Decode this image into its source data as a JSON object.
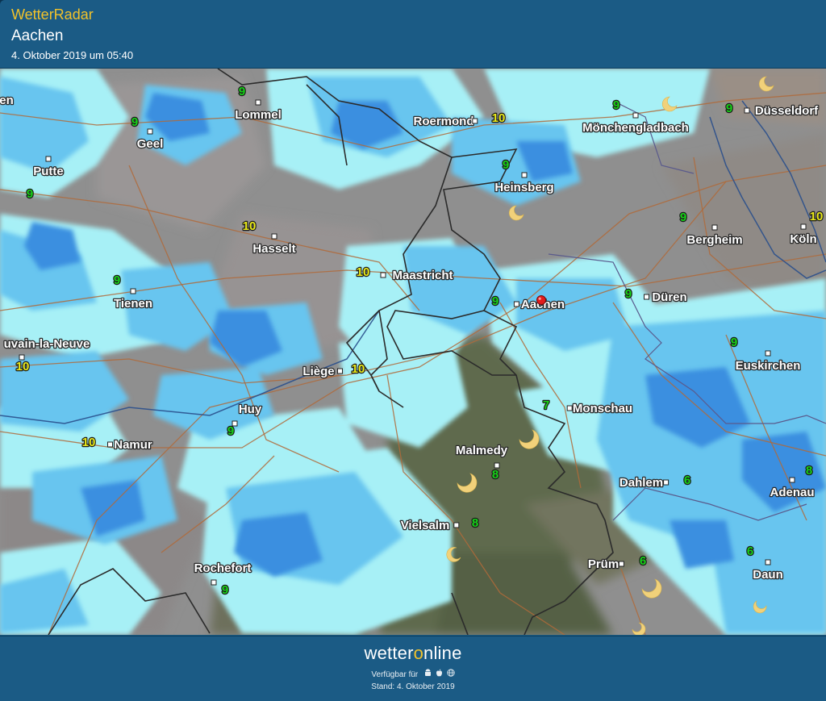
{
  "header": {
    "app_title": "WetterRadar",
    "location": "Aachen",
    "timestamp": "4. Oktober 2019 um 05:40"
  },
  "footer": {
    "brand_prefix": "wetter",
    "brand_o": "o",
    "brand_suffix": "nline",
    "available_label": "Verfügbar für",
    "platform_icons": [
      "android-icon",
      "apple-icon",
      "web-icon"
    ],
    "stand": "Stand: 4. Oktober 2019"
  },
  "colors": {
    "header_bg": "#1b5b85",
    "title_yellow": "#f2c22a",
    "precip_light": "#a7f0f6",
    "precip_mid": "#67c5ef",
    "precip_heavy": "#3a8fe0",
    "clear_night_grey": "#8f8f8f",
    "forest_dark": "#5e6a4d",
    "temp_green": "#17d217",
    "temp_yellow": "#eaea1a",
    "marker_red": "#e21c1c"
  },
  "map": {
    "cities": [
      {
        "name": "Lommel"
      },
      {
        "name": "Roermond"
      },
      {
        "name": "Mönchengladbach"
      },
      {
        "name": "Düsseldorf"
      },
      {
        "name": "Geel"
      },
      {
        "name": "Putte"
      },
      {
        "name": "Heinsberg"
      },
      {
        "name": "Hasselt"
      },
      {
        "name": "Bergheim"
      },
      {
        "name": "Köln"
      },
      {
        "name": "Maastricht"
      },
      {
        "name": "Tienen"
      },
      {
        "name": "Aachen"
      },
      {
        "name": "Düren"
      },
      {
        "name": "uvain-la-Neuve"
      },
      {
        "name": "Euskirchen"
      },
      {
        "name": "Liège"
      },
      {
        "name": "Huy"
      },
      {
        "name": "Monschau"
      },
      {
        "name": "Namur"
      },
      {
        "name": "Malmedy"
      },
      {
        "name": "Dahlem"
      },
      {
        "name": "Adenau"
      },
      {
        "name": "Vielsalm"
      },
      {
        "name": "Rochefort"
      },
      {
        "name": "Prüm"
      },
      {
        "name": "Daun"
      },
      {
        "name": "en"
      }
    ],
    "temperatures": [
      {
        "value": "9",
        "color": "green"
      },
      {
        "value": "9",
        "color": "green"
      },
      {
        "value": "9",
        "color": "green"
      },
      {
        "value": "9",
        "color": "green"
      },
      {
        "value": "10",
        "color": "yellow"
      },
      {
        "value": "9",
        "color": "green"
      },
      {
        "value": "9",
        "color": "green"
      },
      {
        "value": "10",
        "color": "yellow"
      },
      {
        "value": "9",
        "color": "green"
      },
      {
        "value": "10",
        "color": "yellow"
      },
      {
        "value": "9",
        "color": "green"
      },
      {
        "value": "10",
        "color": "yellow"
      },
      {
        "value": "9",
        "color": "green"
      },
      {
        "value": "9",
        "color": "green"
      },
      {
        "value": "9",
        "color": "green"
      },
      {
        "value": "10",
        "color": "yellow"
      },
      {
        "value": "10",
        "color": "yellow"
      },
      {
        "value": "9",
        "color": "green"
      },
      {
        "value": "7",
        "color": "green"
      },
      {
        "value": "10",
        "color": "yellow"
      },
      {
        "value": "8",
        "color": "green"
      },
      {
        "value": "6",
        "color": "green"
      },
      {
        "value": "8",
        "color": "green"
      },
      {
        "value": "8",
        "color": "green"
      },
      {
        "value": "9",
        "color": "green"
      },
      {
        "value": "6",
        "color": "green"
      },
      {
        "value": "6",
        "color": "green"
      }
    ],
    "selected_location_marker": "location-pin-icon",
    "weather_symbol": "moon-icon"
  }
}
